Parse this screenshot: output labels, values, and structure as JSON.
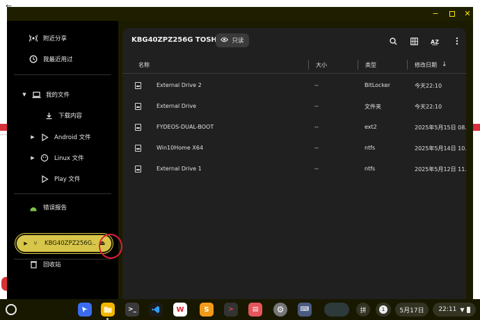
{
  "window": {
    "controls": {
      "minimize": "−",
      "maximize": "",
      "close": "✕"
    }
  },
  "sidebar": {
    "items": [
      {
        "label": "附近分享",
        "icon": "nearby-share-icon"
      },
      {
        "label": "我最近用过",
        "icon": "recent-icon"
      },
      {
        "label": "我的文件",
        "icon": "laptop-icon",
        "expanded": true
      },
      {
        "label": "下载内容",
        "icon": "download-icon"
      },
      {
        "label": "Android 文件",
        "icon": "play-icon"
      },
      {
        "label": "Linux 文件",
        "icon": "linux-icon"
      },
      {
        "label": "Play 文件",
        "icon": "play-icon"
      },
      {
        "label": "错误报告",
        "icon": "android-icon"
      },
      {
        "label": "回收站",
        "icon": "trash-icon"
      }
    ],
    "selected_drive": {
      "label": "KBG40ZPZ256G...",
      "icon": "usb-icon",
      "eject_icon": "eject-icon"
    }
  },
  "main": {
    "title": "KBG40ZPZ256G TOSH...",
    "readonly_label": "只读",
    "columns": {
      "name": "名称",
      "size": "大小",
      "type": "类型",
      "modified": "修改日期"
    },
    "rows": [
      {
        "name": "External Drive 2",
        "size": "--",
        "type": "BitLocker",
        "modified": "今天22:10"
      },
      {
        "name": "External Drive",
        "size": "--",
        "type": "文件夹",
        "modified": "今天22:10"
      },
      {
        "name": "FYDEOS-DUAL-BOOT",
        "size": "--",
        "type": "ext2",
        "modified": "2025年5月15日 08..."
      },
      {
        "name": "Win10Home X64",
        "size": "--",
        "type": "ntfs",
        "modified": "2025年5月14日 10..."
      },
      {
        "name": "External Drive 1",
        "size": "--",
        "type": "ntfs",
        "modified": "2025年5月12日 11..."
      }
    ]
  },
  "shelf": {
    "ime": "拼",
    "notification_count": "1",
    "date": "5月17日",
    "time": "22:11"
  },
  "colors": {
    "accent": "#ffe700",
    "drive_pill": "#d8c64a",
    "annotation": "#e0203a"
  }
}
